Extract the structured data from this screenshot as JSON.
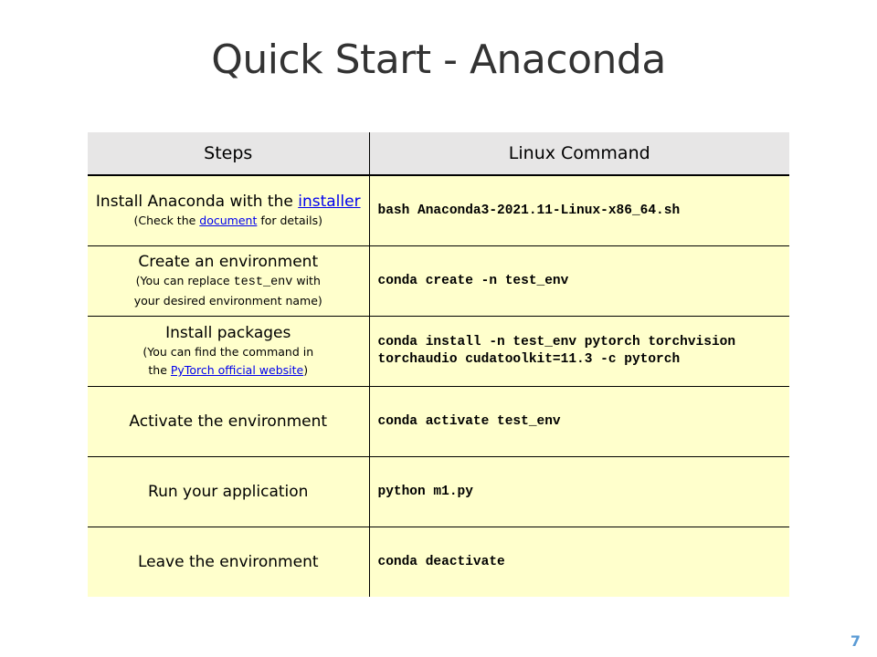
{
  "slide": {
    "title": "Quick Start - Anaconda",
    "page_number": "7"
  },
  "table": {
    "headers": {
      "steps": "Steps",
      "command": "Linux Command"
    },
    "rows": [
      {
        "step_before": "Install Anaconda with the ",
        "step_link": "installer",
        "note_before": "(Check the ",
        "note_link": "document",
        "note_after": " for details)",
        "command": "bash Anaconda3-2021.11-Linux-x86_64.sh"
      },
      {
        "step": "Create an environment",
        "note_line1_before": "(You can replace ",
        "note_code": "test_env",
        "note_line1_after": " with",
        "note_line2": "your desired environment name)",
        "command": "conda create -n test_env"
      },
      {
        "step": "Install packages",
        "note_line1": "(You can find the command in",
        "note_line2_before": "the ",
        "note_link": "PyTorch official website",
        "note_line2_after": ")",
        "command_line1": "conda install -n test_env pytorch torchvision",
        "command_line2": "torchaudio cudatoolkit=11.3 -c pytorch"
      },
      {
        "step": "Activate the environment",
        "command": "conda activate test_env"
      },
      {
        "step": "Run your application",
        "command": "python m1.py"
      },
      {
        "step": "Leave the environment",
        "command": "conda deactivate"
      }
    ]
  },
  "colors": {
    "header_bg": "#e7e6e6",
    "row_bg": "#ffffcc",
    "link": "#0000ee",
    "page_number": "#5b9bd5",
    "title": "#333333"
  }
}
